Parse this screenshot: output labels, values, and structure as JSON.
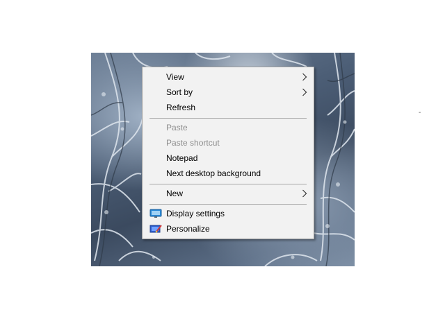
{
  "menu": {
    "items": [
      {
        "label": "View",
        "submenu": true,
        "disabled": false
      },
      {
        "label": "Sort by",
        "submenu": true,
        "disabled": false
      },
      {
        "label": "Refresh",
        "submenu": false,
        "disabled": false
      },
      {
        "label": "Paste",
        "submenu": false,
        "disabled": true
      },
      {
        "label": "Paste shortcut",
        "submenu": false,
        "disabled": true
      },
      {
        "label": "Notepad",
        "submenu": false,
        "disabled": false
      },
      {
        "label": "Next desktop background",
        "submenu": false,
        "disabled": false
      },
      {
        "label": "New",
        "submenu": true,
        "disabled": false
      },
      {
        "label": "Display settings",
        "icon": "display-settings-icon",
        "disabled": false
      },
      {
        "label": "Personalize",
        "icon": "personalize-icon",
        "disabled": false
      }
    ]
  },
  "desktop": {
    "stray_mark": "-",
    "wallpaper": "snowy-branches"
  },
  "colors": {
    "menu_background": "#f2f2f2",
    "disabled_text": "#8d8d8d",
    "separator": "#a6a6a6"
  }
}
